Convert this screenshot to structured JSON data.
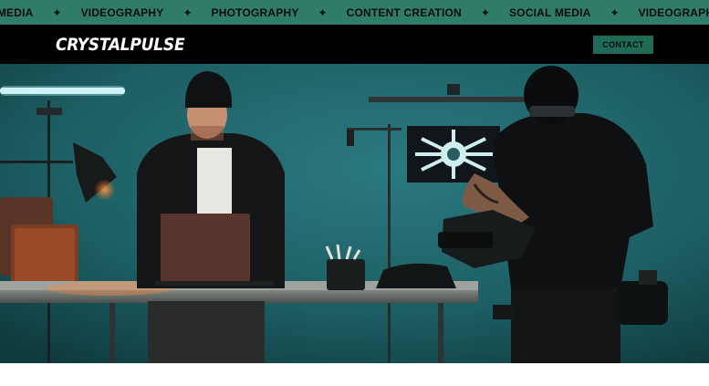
{
  "ticker": {
    "items": [
      "L MEDIA",
      "VIDEOGRAPHY",
      "PHOTOGRAPHY",
      "CONTENT CREATION",
      "SOCIAL MEDIA",
      "VIDEOGRAPH"
    ],
    "separator_icon": "four-point-star-icon",
    "background": "#2f7d68"
  },
  "header": {
    "logo": "CRYSTALPULSE",
    "contact_label": "CONTACT",
    "background": "#000000",
    "button_color": "#1f6b58"
  },
  "hero": {
    "description_icon": "studio-photo",
    "background": "#1b5a5e"
  }
}
